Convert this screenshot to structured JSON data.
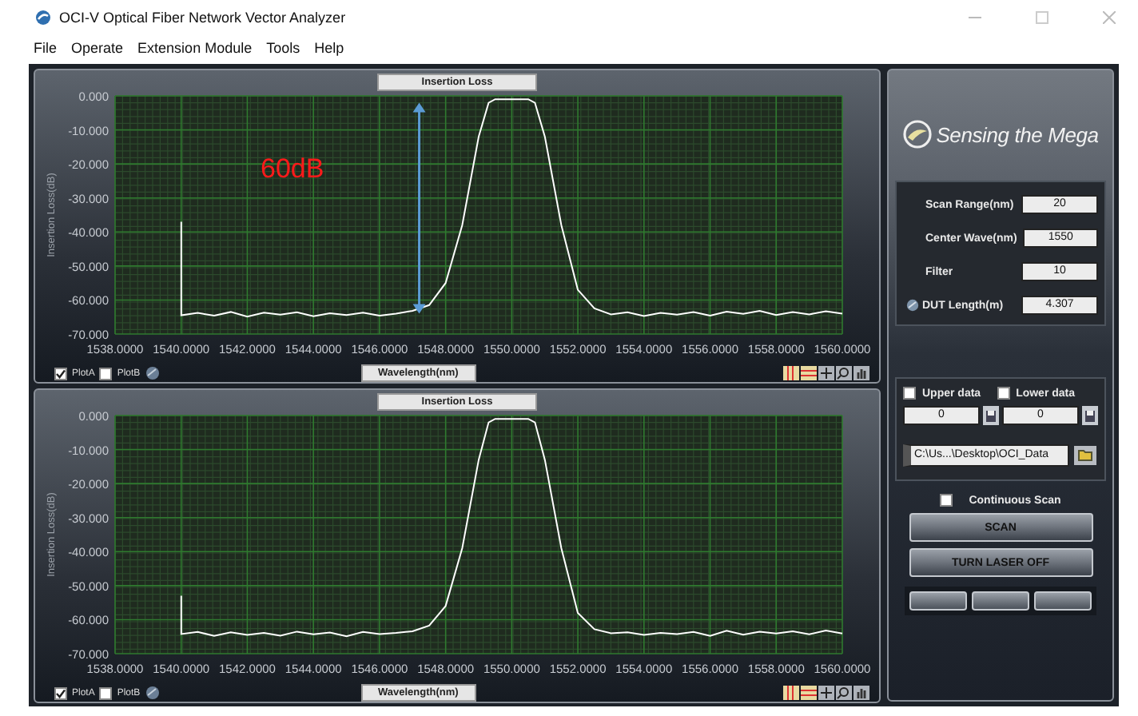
{
  "window": {
    "title": "OCI-V  Optical Fiber Network Vector Analyzer"
  },
  "menu": [
    "File",
    "Operate",
    "Extension Module",
    "Tools",
    "Help"
  ],
  "charts": [
    {
      "legend": [
        {
          "label": "PlotA",
          "checked": true
        },
        {
          "label": "PlotB",
          "checked": false
        }
      ],
      "chart_data": {
        "type": "line",
        "title": "Insertion Loss",
        "xlabel": "Wavelength(nm)",
        "ylabel": "Insertion Loss(dB)",
        "x": [
          1540,
          1540,
          1540.5,
          1541,
          1541.5,
          1542,
          1542.5,
          1543,
          1543.5,
          1544,
          1544.5,
          1545,
          1545.5,
          1546,
          1546.5,
          1547,
          1547.5,
          1548,
          1548.5,
          1549,
          1549.3,
          1549.5,
          1550,
          1550.5,
          1550.7,
          1551,
          1551.5,
          1552,
          1552.5,
          1553,
          1553.5,
          1554,
          1554.5,
          1555,
          1555.5,
          1556,
          1556.5,
          1557,
          1557.5,
          1558,
          1558.5,
          1559,
          1559.5,
          1560
        ],
        "series": [
          {
            "color": "#ffffff",
            "values": [
              -37,
              -64.5,
              -63.8,
              -64.6,
              -63.5,
              -64.9,
              -63.7,
              -64.3,
              -63.6,
              -64.8,
              -63.9,
              -64.4,
              -63.7,
              -64.6,
              -64,
              -63.2,
              -61.5,
              -55,
              -38,
              -12,
              -2,
              -1,
              -1,
              -1,
              -2,
              -12,
              -38,
              -57,
              -62.5,
              -64.2,
              -63.6,
              -64.7,
              -63.8,
              -64.3,
              -63.5,
              -64.6,
              -63.4,
              -64.1,
              -63.2,
              -64.4,
              -63.5,
              -64.2,
              -63.3,
              -64
            ]
          }
        ],
        "xlim": [
          1538,
          1560
        ],
        "ylim": [
          -70,
          0
        ],
        "xticks": [
          {
            "value": 1538,
            "label": "1538.0000"
          },
          {
            "value": 1540,
            "label": "1540.0000"
          },
          {
            "value": 1542,
            "label": "1542.0000"
          },
          {
            "value": 1544,
            "label": "1544.0000"
          },
          {
            "value": 1546,
            "label": "1546.0000"
          },
          {
            "value": 1548,
            "label": "1548.0000"
          },
          {
            "value": 1550,
            "label": "1550.0000"
          },
          {
            "value": 1552,
            "label": "1552.0000"
          },
          {
            "value": 1554,
            "label": "1554.0000"
          },
          {
            "value": 1556,
            "label": "1556.0000"
          },
          {
            "value": 1558,
            "label": "1558.0000"
          },
          {
            "value": 1560,
            "label": "1560.0000"
          }
        ],
        "yticks": [
          {
            "value": 0,
            "label": "0.000"
          },
          {
            "value": -10,
            "label": "-10.000"
          },
          {
            "value": -20,
            "label": "-20.000"
          },
          {
            "value": -30,
            "label": "-30.000"
          },
          {
            "value": -40,
            "label": "-40.000"
          },
          {
            "value": -50,
            "label": "-50.000"
          },
          {
            "value": -60,
            "label": "-60.000"
          },
          {
            "value": -70,
            "label": "-70.000"
          }
        ],
        "grid": true,
        "annotations": [
          "60dB"
        ]
      }
    },
    {
      "legend": [
        {
          "label": "PlotA",
          "checked": true
        },
        {
          "label": "PlotB",
          "checked": false
        }
      ],
      "chart_data": {
        "type": "line",
        "title": "Insertion Loss",
        "xlabel": "Wavelength(nm)",
        "ylabel": "Insertion Loss(dB)",
        "x": [
          1540,
          1540,
          1540.5,
          1541,
          1541.5,
          1542,
          1542.5,
          1543,
          1543.5,
          1544,
          1544.5,
          1545,
          1545.5,
          1546,
          1546.5,
          1547,
          1547.5,
          1548,
          1548.5,
          1549,
          1549.3,
          1549.5,
          1550,
          1550.5,
          1550.7,
          1551,
          1551.5,
          1552,
          1552.5,
          1553,
          1553.5,
          1554,
          1554.5,
          1555,
          1555.5,
          1556,
          1556.5,
          1557,
          1557.5,
          1558,
          1558.5,
          1559,
          1559.5,
          1560
        ],
        "series": [
          {
            "color": "#ffffff",
            "values": [
              -53,
              -64.2,
              -63.6,
              -64.8,
              -63.7,
              -64.5,
              -63.9,
              -64.7,
              -63.5,
              -64.3,
              -63.8,
              -64.9,
              -63.6,
              -64.2,
              -63.9,
              -63.4,
              -61.8,
              -56,
              -39,
              -13,
              -2,
              -1,
              -1,
              -1,
              -2,
              -13,
              -39,
              -58,
              -62.8,
              -64,
              -63.7,
              -64.5,
              -63.9,
              -64.2,
              -63.6,
              -64.8,
              -63.3,
              -64.4,
              -63.5,
              -64.1,
              -63.4,
              -64.3,
              -63.2,
              -64.1
            ]
          }
        ],
        "xlim": [
          1538,
          1560
        ],
        "ylim": [
          -70,
          0
        ],
        "xticks": [
          {
            "value": 1538,
            "label": "1538.0000"
          },
          {
            "value": 1540,
            "label": "1540.0000"
          },
          {
            "value": 1542,
            "label": "1542.0000"
          },
          {
            "value": 1544,
            "label": "1544.0000"
          },
          {
            "value": 1546,
            "label": "1546.0000"
          },
          {
            "value": 1548,
            "label": "1548.0000"
          },
          {
            "value": 1550,
            "label": "1550.0000"
          },
          {
            "value": 1552,
            "label": "1552.0000"
          },
          {
            "value": 1554,
            "label": "1554.0000"
          },
          {
            "value": 1556,
            "label": "1556.0000"
          },
          {
            "value": 1558,
            "label": "1558.0000"
          },
          {
            "value": 1560,
            "label": "1560.0000"
          }
        ],
        "yticks": [
          {
            "value": 0,
            "label": "0.000"
          },
          {
            "value": -10,
            "label": "-10.000"
          },
          {
            "value": -20,
            "label": "-20.000"
          },
          {
            "value": -30,
            "label": "-30.000"
          },
          {
            "value": -40,
            "label": "-40.000"
          },
          {
            "value": -50,
            "label": "-50.000"
          },
          {
            "value": -60,
            "label": "-60.000"
          },
          {
            "value": -70,
            "label": "-70.000"
          }
        ],
        "grid": true
      }
    }
  ],
  "brand": "Sensing the Mega",
  "settings": [
    {
      "label": "Scan Range(nm)",
      "value": "20",
      "kind": "plain"
    },
    {
      "label": "Center Wave(nm)",
      "value": "1550",
      "kind": "plain"
    },
    {
      "label": "Filter",
      "value": "10",
      "kind": "plain"
    },
    {
      "label": "DUT Length(m)",
      "value": "4.307",
      "kind": "linked"
    }
  ],
  "export": {
    "channels": [
      {
        "label": "Upper data",
        "checked": false,
        "value": "0"
      },
      {
        "label": "Lower data",
        "checked": false,
        "value": "0"
      }
    ],
    "path": "C:\\Us...\\Desktop\\OCI_Data"
  },
  "continuous_scan": {
    "label": "Continuous Scan",
    "checked": false
  },
  "buttons": [
    "SCAN",
    "TURN LASER OFF"
  ]
}
